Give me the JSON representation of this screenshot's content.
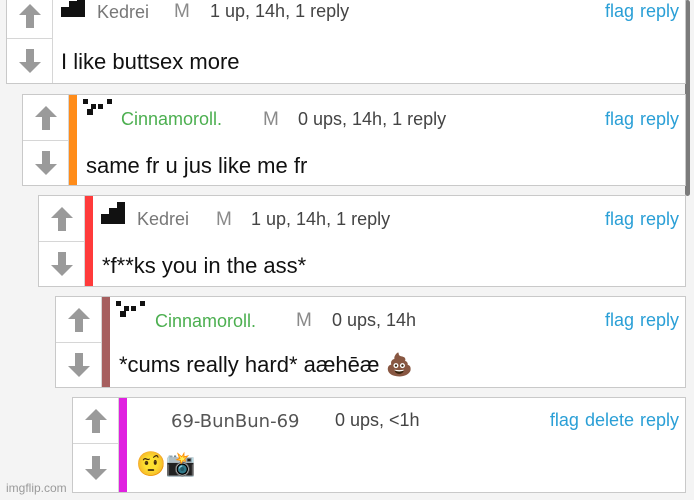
{
  "labels": {
    "flag": "flag",
    "reply": "reply",
    "delete": "delete"
  },
  "comments": [
    {
      "username": "Kedrei",
      "user_color": "#777777",
      "flair": "M",
      "meta": "1 up, 14h, 1 reply",
      "body": "I like buttsex more",
      "stripe_color": "",
      "avatar": "pixel-block-avatar"
    },
    {
      "username": "Cinnamoroll.",
      "user_color": "#4caf50",
      "flair": "M",
      "meta": "0 ups, 14h, 1 reply",
      "body": "same fr u jus like me fr",
      "stripe_color": "#ff8c1a",
      "avatar": "pixel-dots-avatar"
    },
    {
      "username": "Kedrei",
      "user_color": "#777777",
      "flair": "M",
      "meta": "1 up, 14h, 1 reply",
      "body": "*f**ks you in the ass*",
      "stripe_color": "#ff3b3b",
      "avatar": "pixel-block-avatar"
    },
    {
      "username": "Cinnamoroll.",
      "user_color": "#4caf50",
      "flair": "M",
      "meta": "0 ups, 14h",
      "body": "*cums really hard* aæhēæ 💩",
      "stripe_color": "#a65f5f",
      "avatar": "pixel-dots-avatar"
    },
    {
      "username": "69-BunBun-69",
      "user_color": "#555555",
      "flair": "",
      "meta": "0 ups, <1h",
      "body": "🤨📸",
      "stripe_color": "#e020e0",
      "avatar": ""
    }
  ],
  "watermark": "imgflip.com"
}
